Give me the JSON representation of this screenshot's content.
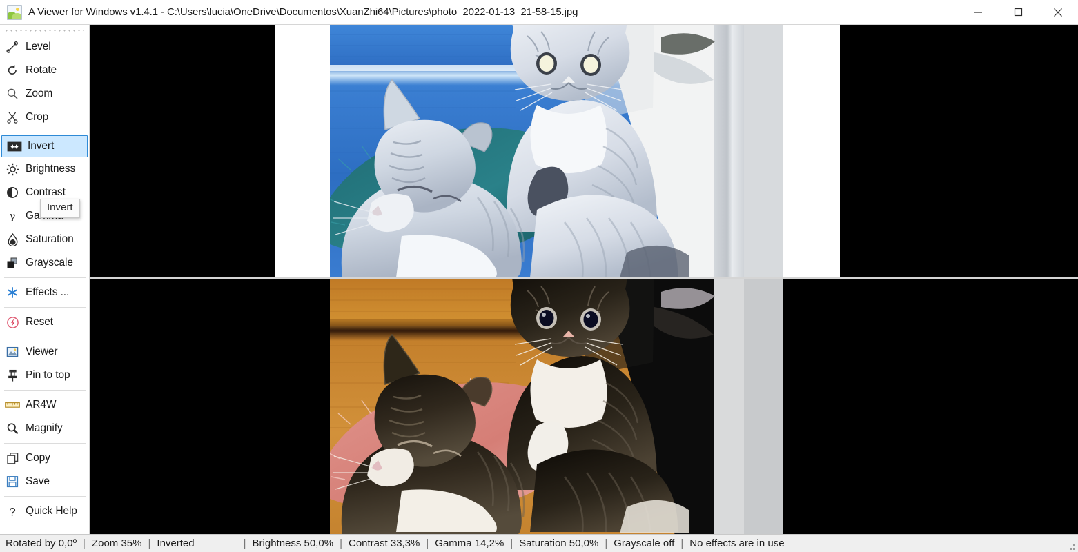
{
  "window": {
    "title": "A Viewer for Windows v1.4.1 - C:\\Users\\lucia\\OneDrive\\Documentos\\XuanZhi64\\Pictures\\photo_2022-01-13_21-58-15.jpg",
    "app_icon": "picture-icon",
    "controls": {
      "minimize": "minimize-icon",
      "maximize": "maximize-icon",
      "close": "close-icon"
    }
  },
  "sidebar": {
    "grip": "drag-grip",
    "groups": [
      {
        "items": [
          {
            "label": "Level",
            "icon": "level-icon",
            "selected": false
          },
          {
            "label": "Rotate",
            "icon": "rotate-icon",
            "selected": false
          },
          {
            "label": "Zoom",
            "icon": "zoom-icon",
            "selected": false
          },
          {
            "label": "Crop",
            "icon": "crop-icon",
            "selected": false
          }
        ]
      },
      {
        "items": [
          {
            "label": "Invert",
            "icon": "invert-icon",
            "selected": true
          },
          {
            "label": "Brightness",
            "icon": "brightness-icon",
            "selected": false
          },
          {
            "label": "Contrast",
            "icon": "contrast-icon",
            "selected": false
          },
          {
            "label": "Gamma",
            "icon": "gamma-icon",
            "selected": false
          },
          {
            "label": "Saturation",
            "icon": "saturation-icon",
            "selected": false
          },
          {
            "label": "Grayscale",
            "icon": "grayscale-icon",
            "selected": false
          }
        ]
      },
      {
        "items": [
          {
            "label": "Effects ...",
            "icon": "effects-icon",
            "selected": false
          }
        ]
      },
      {
        "items": [
          {
            "label": "Reset",
            "icon": "reset-icon",
            "selected": false
          }
        ]
      },
      {
        "items": [
          {
            "label": "Viewer",
            "icon": "viewer-icon",
            "selected": false
          },
          {
            "label": "Pin to top",
            "icon": "pin-icon",
            "selected": false
          }
        ]
      },
      {
        "items": [
          {
            "label": "AR4W",
            "icon": "ruler-icon",
            "selected": false
          },
          {
            "label": "Magnify",
            "icon": "magnify-icon",
            "selected": false
          }
        ]
      },
      {
        "items": [
          {
            "label": "Copy",
            "icon": "copy-icon",
            "selected": false
          },
          {
            "label": "Save",
            "icon": "save-icon",
            "selected": false
          }
        ]
      },
      {
        "items": [
          {
            "label": "Quick Help",
            "icon": "question-icon",
            "selected": false
          }
        ]
      }
    ]
  },
  "tooltip": {
    "text": "Invert"
  },
  "statusbar": {
    "items": [
      "Rotated by 0,0º",
      "Zoom 35%",
      "Inverted",
      "Brightness 50,0%",
      "Contrast 33,3%",
      "Gamma 14,2%",
      "Saturation 50,0%",
      "Grayscale off",
      "No effects are in use"
    ],
    "separator": "|",
    "resize_grip": "resize-grip"
  },
  "canvas": {
    "background_color": "#000000",
    "letterbox_color": "#ffffff",
    "preview_top_label": "inverted-preview",
    "preview_bottom_label": "original-preview",
    "subject": "two tabby cats resting on a pink fluffy bed against a wooden wall"
  },
  "colors": {
    "selection_fill": "#cce8ff",
    "selection_border": "#2e8ad6",
    "statusbar_bg": "#efefef",
    "sidebar_border": "#cfcfcf"
  }
}
